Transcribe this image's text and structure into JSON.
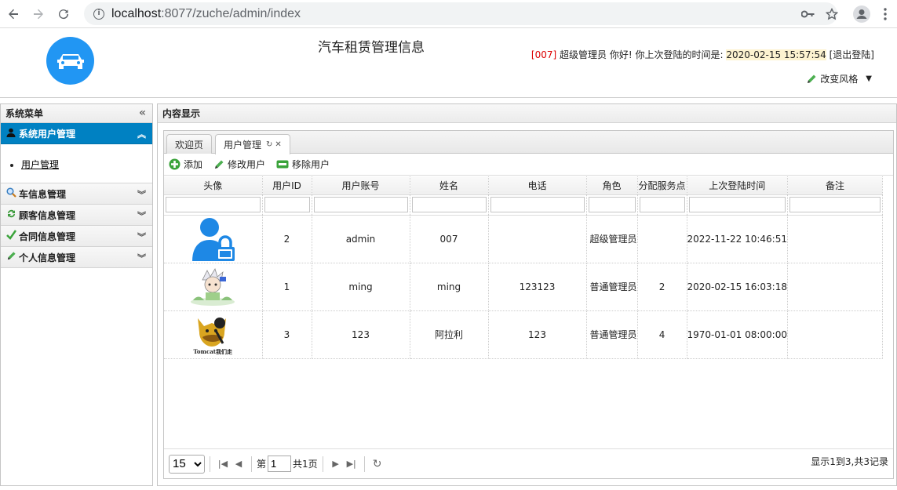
{
  "browser": {
    "url_host": "localhost",
    "url_path": ":8077/zuche/admin/index"
  },
  "header": {
    "title": "汽车租赁管理信息",
    "user_id": "[007]",
    "greeting": "超级管理员 你好! 你上次登陆的时间是:",
    "last_login": "2020-02-15 15:57:54",
    "logout": "[退出登陆]",
    "theme_label": "改变风格"
  },
  "sidebar": {
    "title": "系统菜单",
    "sections": [
      {
        "label": "系统用户管理",
        "icon": "user-icon",
        "active": true,
        "items": [
          {
            "label": "用户管理"
          }
        ]
      },
      {
        "label": "车信息管理",
        "icon": "search-icon"
      },
      {
        "label": "顾客信息管理",
        "icon": "refresh-icon"
      },
      {
        "label": "合同信息管理",
        "icon": "check-icon"
      },
      {
        "label": "个人信息管理",
        "icon": "pencil-icon"
      }
    ]
  },
  "main": {
    "title": "内容显示",
    "tabs": [
      {
        "label": "欢迎页"
      },
      {
        "label": "用户管理"
      }
    ],
    "toolbar": {
      "add": "添加",
      "edit": "修改用户",
      "remove": "移除用户"
    },
    "columns": [
      "头像",
      "用户ID",
      "用户账号",
      "姓名",
      "电话",
      "角色",
      "分配服务点",
      "上次登陆时间",
      "备注"
    ],
    "rows": [
      {
        "avatar": "lock-user-avatar",
        "id": "2",
        "account": "admin",
        "name": "007",
        "phone": "",
        "role": "超级管理员",
        "service": "",
        "last_login": "2022-11-22 10:46:51",
        "note": ""
      },
      {
        "avatar": "anime-avatar",
        "id": "1",
        "account": "ming",
        "name": "ming",
        "phone": "123123",
        "role": "普通管理员",
        "service": "2",
        "last_login": "2020-02-15 16:03:18",
        "note": ""
      },
      {
        "avatar": "tomcat-avatar",
        "id": "3",
        "account": "123",
        "name": "阿拉利",
        "phone": "123",
        "role": "普通管理员",
        "service": "4",
        "last_login": "1970-01-01 08:00:00",
        "note": ""
      }
    ],
    "tomcat_caption": "Tomcat我们走",
    "pager": {
      "page_size": "15",
      "page_prefix": "第",
      "page_value": "1",
      "page_total": "共1页",
      "info": "显示1到3,共3记录"
    }
  },
  "colors": {
    "accent": "#0081c2",
    "logo": "#2196f3",
    "user_id_red": "#dd0000"
  }
}
